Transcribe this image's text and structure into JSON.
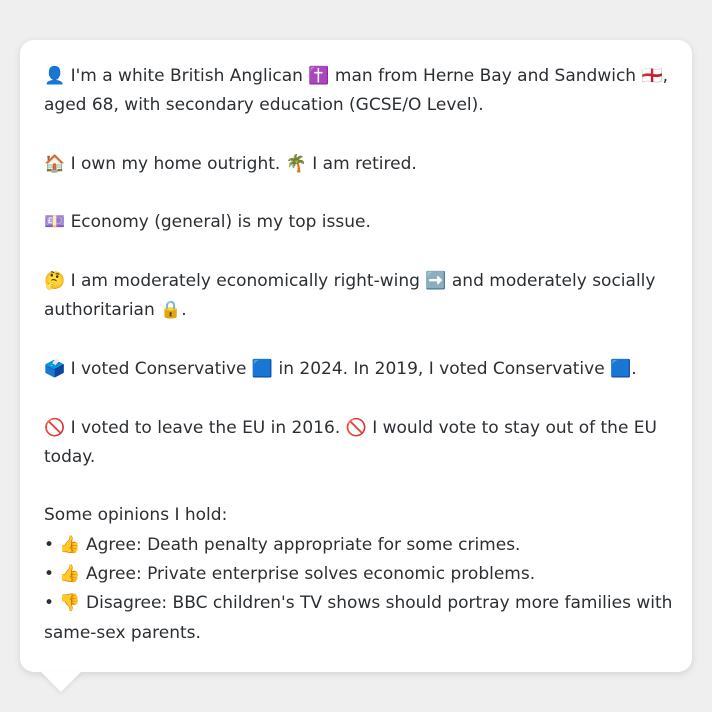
{
  "paragraphs": [
    {
      "lines": [
        "👤 I'm a white British Anglican ✝️ man from Herne Bay and Sandwich 🏴󠁧󠁢󠁥󠁮󠁧󠁿,",
        "aged 68, with secondary education (GCSE/O Level)."
      ]
    },
    {
      "lines": [
        "🏠 I own my home outright. 🌴 I am retired."
      ]
    },
    {
      "lines": [
        "💷 Economy (general) is my top issue."
      ]
    },
    {
      "lines": [
        "🤔 I am moderately economically right-wing ➡️ and moderately socially",
        "authoritarian 🔒."
      ]
    },
    {
      "lines": [
        "🗳️ I voted Conservative 🟦 in 2024. In 2019, I voted Conservative 🟦."
      ]
    },
    {
      "lines": [
        "🚫 I voted to leave the EU in 2016. 🚫 I would vote to stay out of the EU",
        "today."
      ]
    },
    {
      "lines": [
        "Some opinions I hold:",
        "• 👍 Agree: Death penalty appropriate for some crimes.",
        "• 👍 Agree: Private enterprise solves economic problems.",
        "• 👎 Disagree: BBC children's TV shows should portray more families with",
        "same-sex parents."
      ]
    }
  ]
}
